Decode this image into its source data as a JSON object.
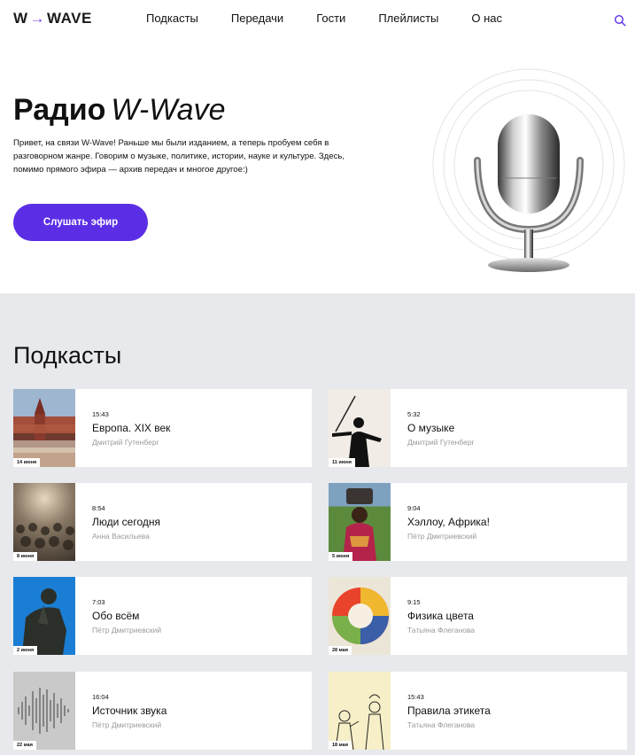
{
  "header": {
    "logo_left": "W",
    "logo_arrow": "→",
    "logo_right": "WAVE",
    "nav": [
      "Подкасты",
      "Передачи",
      "Гости",
      "Плейлисты",
      "О нас"
    ],
    "search_icon": "search-icon"
  },
  "hero": {
    "title_bold": "Радио",
    "title_italic": "W-Wave",
    "description": "Привет, на связи W-Wave! Раньше мы были изданием, а теперь пробуем себя в разговорном жанре. Говорим о музыке, политике, истории, науке и культуре. Здесь, помимо прямого эфира — архив передач и многое другое:)",
    "listen_button": "Слушать эфир",
    "accent_color": "#5b2ee6"
  },
  "podcasts": {
    "title": "Подкасты",
    "items": [
      {
        "date": "14 июня",
        "duration": "15:43",
        "title": "Европа. XIX век",
        "author": "Дмитрий Гутенберг",
        "image": "town-photo"
      },
      {
        "date": "11 июня",
        "duration": "5:32",
        "title": "О музыке",
        "author": "Дмитрий Гутенберг",
        "image": "violinist-photo"
      },
      {
        "date": "8 июня",
        "duration": "8:54",
        "title": "Люди сегодня",
        "author": "Анна Васильева",
        "image": "crowd-photo"
      },
      {
        "date": "5 июня",
        "duration": "9:04",
        "title": "Хэллоу, Африка!",
        "author": "Пётр Дмитриевский",
        "image": "africa-photo"
      },
      {
        "date": "2 июня",
        "duration": "7:03",
        "title": "Обо всём",
        "author": "Пётр Дмитриевский",
        "image": "thinker-photo"
      },
      {
        "date": "28 мая",
        "duration": "9:15",
        "title": "Физика цвета",
        "author": "Татьяна Флеганова",
        "image": "color-wheel"
      },
      {
        "date": "22 мая",
        "duration": "16:04",
        "title": "Источник звука",
        "author": "Пётр Дмитриевский",
        "image": "soundwave"
      },
      {
        "date": "18 мая",
        "duration": "15:43",
        "title": "Правила этикета",
        "author": "Татьяна Флеганова",
        "image": "etiquette-drawing"
      }
    ]
  }
}
